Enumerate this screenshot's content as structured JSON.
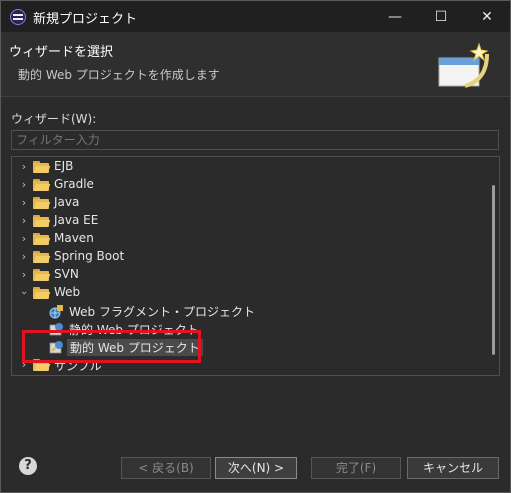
{
  "window": {
    "title": "新規プロジェクト",
    "minimize": "—",
    "maximize": "☐",
    "close": "✕"
  },
  "header": {
    "title": "ウィザードを選択",
    "description": "動的 Web プロジェクトを作成します"
  },
  "wizards_label": "ウィザード(W):",
  "filter": {
    "placeholder": "フィルター入力",
    "value": ""
  },
  "tree": {
    "items": [
      {
        "label": "EJB",
        "expanded": false
      },
      {
        "label": "Gradle",
        "expanded": false
      },
      {
        "label": "Java",
        "expanded": false
      },
      {
        "label": "Java EE",
        "expanded": false
      },
      {
        "label": "Maven",
        "expanded": false
      },
      {
        "label": "Spring Boot",
        "expanded": false
      },
      {
        "label": "SVN",
        "expanded": false
      },
      {
        "label": "Web",
        "expanded": true,
        "children": [
          {
            "label": "Web フラグメント・プロジェクト"
          },
          {
            "label": "静的 Web プロジェクト"
          },
          {
            "label": "動的 Web プロジェクト",
            "selected": true
          }
        ]
      },
      {
        "label": "サンプル",
        "expanded": false
      }
    ]
  },
  "buttons": {
    "help": "?",
    "back": "< 戻る(B)",
    "next": "次へ(N) >",
    "finish": "完了(F)",
    "cancel": "キャンセル"
  },
  "colors": {
    "highlight": "#e0141e",
    "folder": "#e8b84a"
  }
}
